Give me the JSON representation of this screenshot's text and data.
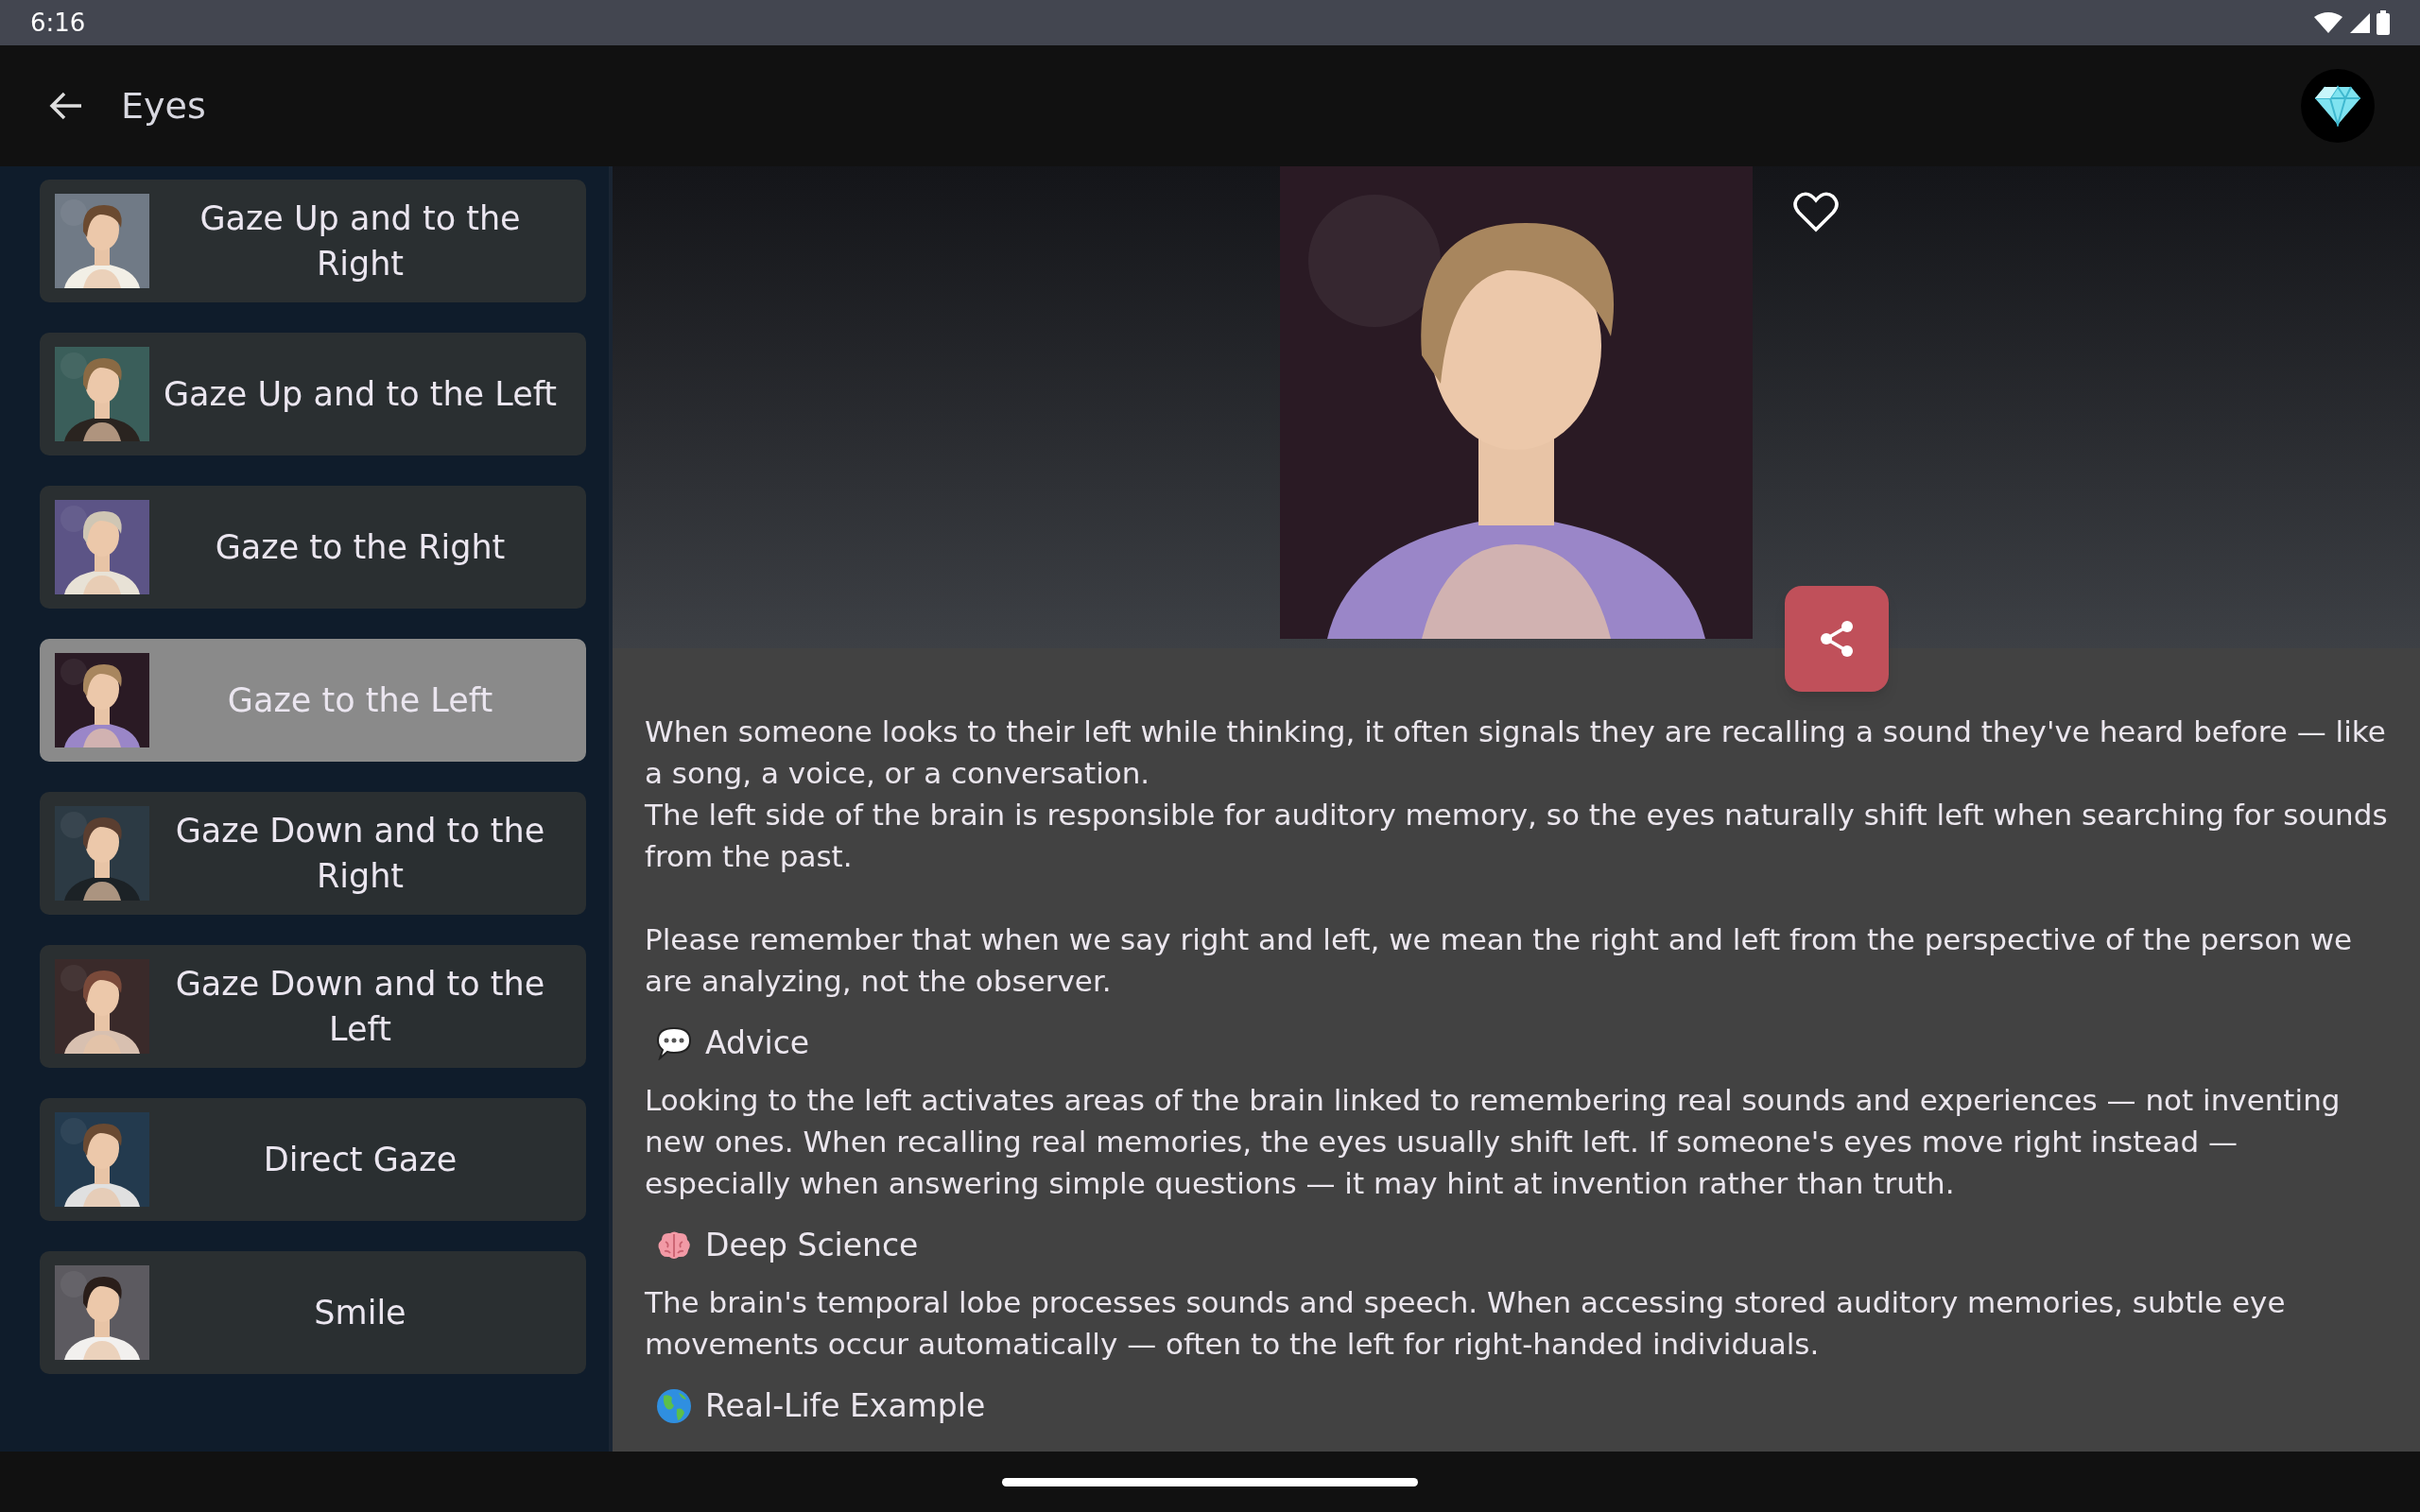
{
  "status_bar": {
    "time": "6:16"
  },
  "app_bar": {
    "title": "Eyes"
  },
  "sidebar": {
    "items": [
      {
        "label": "Gaze Up and to the Right",
        "selected": false
      },
      {
        "label": "Gaze Up and to the Left",
        "selected": false
      },
      {
        "label": "Gaze to the Right",
        "selected": false
      },
      {
        "label": "Gaze to the Left",
        "selected": true
      },
      {
        "label": "Gaze Down and to the Right",
        "selected": false
      },
      {
        "label": "Gaze Down and to the Left",
        "selected": false
      },
      {
        "label": "Direct Gaze",
        "selected": false
      },
      {
        "label": "Smile",
        "selected": false
      }
    ]
  },
  "detail": {
    "favorited": false,
    "paragraphs": [
      "When someone looks to their left while thinking, it often signals they are recalling a sound they've heard before — like a song, a voice, or a conversation.",
      "The left side of the brain is responsible for auditory memory, so the eyes naturally shift left when searching for sounds from the past.",
      "Please remember that when we say right and left, we mean the right and left from the perspective of the person we are analyzing, not the observer."
    ],
    "sections": [
      {
        "kind": "advice",
        "heading": "Advice",
        "body": "Looking to the left activates areas of the brain linked to remembering real sounds and experiences — not inventing new ones. When recalling real memories, the eyes usually shift left. If someone's eyes move right instead — especially when answering simple questions — it may hint at invention rather than truth."
      },
      {
        "kind": "science",
        "heading": "Deep Science",
        "body": "The brain's temporal lobe processes sounds and speech. When accessing stored auditory memories, subtle eye movements occur automatically — often to the left for right-handed individuals."
      },
      {
        "kind": "example",
        "heading": "Real-Life Example"
      }
    ]
  }
}
